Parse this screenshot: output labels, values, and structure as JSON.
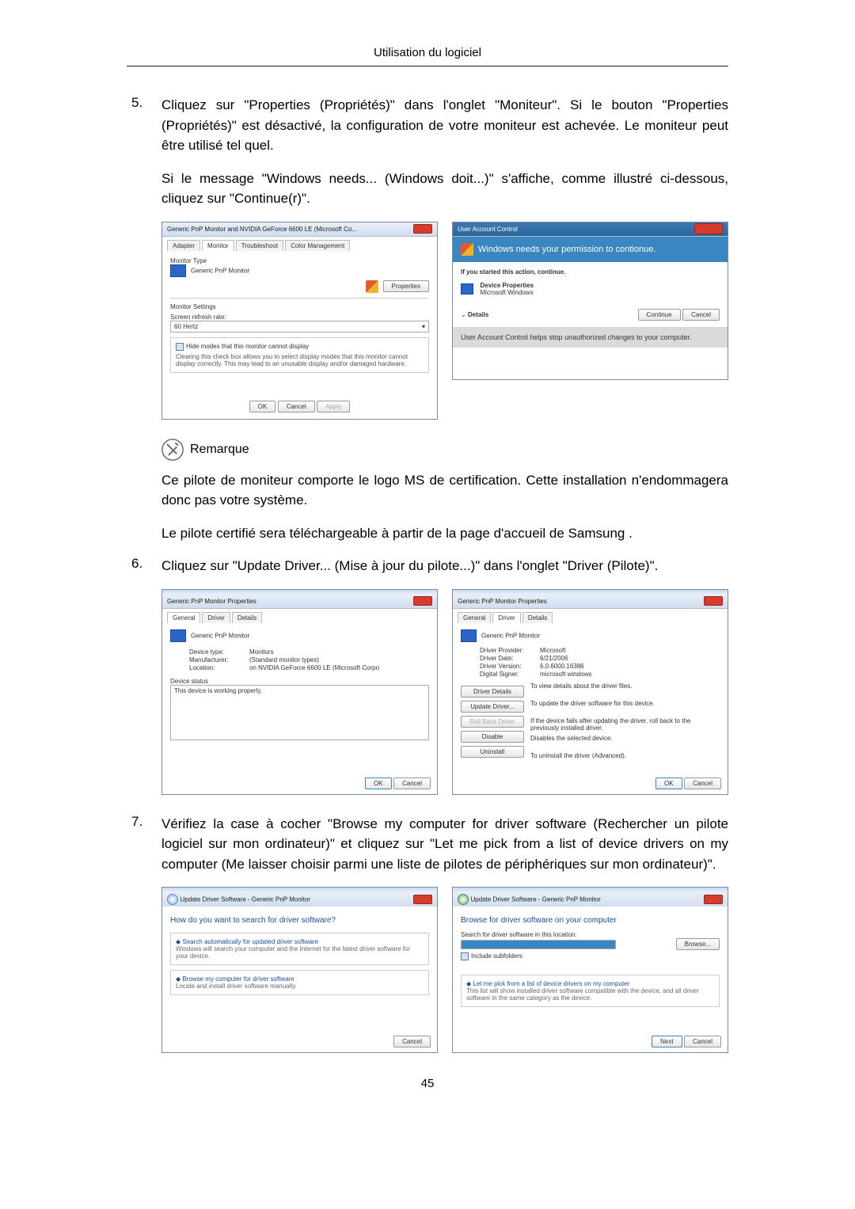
{
  "header": {
    "title": "Utilisation du logiciel"
  },
  "step5": {
    "num": "5.",
    "para1": "Cliquez sur \"Properties (Propriétés)\" dans l'onglet \"Moniteur\". Si le bouton \"Properties (Propriétés)\" est désactivé, la configuration de votre moniteur est achevée. Le moniteur peut être utilisé tel quel.",
    "para2": "Si le message \"Windows needs... (Windows doit...)\" s'affiche, comme illustré ci-dessous, cliquez sur \"Continue(r)\"."
  },
  "win1": {
    "title": "Generic PnP Monitor and NVIDIA GeForce 6600 LE (Microsoft Co...",
    "tabs": {
      "adapter": "Adapter",
      "monitor": "Monitor",
      "troubleshoot": "Troubleshoot",
      "color": "Color Management"
    },
    "monitor_type": "Monitor Type",
    "monitor_name": "Generic PnP Monitor",
    "properties": "Properties",
    "settings": "Monitor Settings",
    "refresh_lbl": "Screen refresh rate:",
    "refresh_val": "60 Hertz",
    "hide": "Hide modes that this monitor cannot display",
    "hide_desc": "Clearing this check box allows you to select display modes that this monitor cannot display correctly. This may lead to an unusable display and/or damaged hardware.",
    "ok": "OK",
    "cancel": "Cancel",
    "apply": "Apply"
  },
  "win2": {
    "title": "User Account Control",
    "bar": "Windows needs your permission to contionue.",
    "if_started": "If you started this action, continue.",
    "devprop": "Device Properties",
    "msw": "Microsoft Windows",
    "details": "Details",
    "continue": "Continue",
    "cancel": "Cancel",
    "helps": "User Account Control helps stop unauthorized changes to your computer."
  },
  "note": {
    "label": "Remarque",
    "p1": "Ce pilote de moniteur comporte le logo MS de certification. Cette installation n'endommagera donc pas votre système.",
    "p2": "Le pilote certifié sera téléchargeable à partir de la page d'accueil de Samsung ."
  },
  "step6": {
    "num": "6.",
    "para": "Cliquez sur \"Update Driver... (Mise à jour du pilote...)\" dans l'onglet \"Driver (Pilote)\"."
  },
  "win3": {
    "title": "Generic PnP Monitor Properties",
    "tabs": {
      "general": "General",
      "driver": "Driver",
      "details": "Details"
    },
    "name": "Generic PnP Monitor",
    "dt": "Device type:",
    "dt_v": "Monitors",
    "mf": "Manufacturer:",
    "mf_v": "(Standard monitor types)",
    "loc": "Location:",
    "loc_v": "on NVIDIA GeForce 6600 LE (Microsoft Corpo",
    "ds": "Device status",
    "ds_v": "This device is working properly.",
    "ok": "OK",
    "cancel": "Cancel"
  },
  "win4": {
    "title": "Generic PnP Monitor Properties",
    "tabs": {
      "general": "General",
      "driver": "Driver",
      "details": "Details"
    },
    "name": "Generic PnP Monitor",
    "dp": "Driver Provider:",
    "dp_v": "Microsoft",
    "dd": "Driver Date:",
    "dd_v": "6/21/2006",
    "dv": "Driver Version:",
    "dv_v": "6.0.6000.16386",
    "dsg": "Digital Signer:",
    "dsg_v": "microsoft windows",
    "b1": "Driver Details",
    "b1_d": "To view details about the driver files.",
    "b2": "Update Driver...",
    "b2_d": "To update the driver software for this device.",
    "b3": "Roll Back Driver",
    "b3_d": "If the device fails after updating the driver, roll back to the previously installed driver.",
    "b4": "Disable",
    "b4_d": "Disables the selected device.",
    "b5": "Uninstall",
    "b5_d": "To uninstall the driver (Advanced).",
    "ok": "OK",
    "cancel": "Cancel"
  },
  "step7": {
    "num": "7.",
    "para": "Vérifiez la case à cocher \"Browse my computer for driver software (Rechercher un pilote logiciel sur mon ordinateur)\" et cliquez sur \"Let me pick from a list of device drivers on my computer (Me laisser choisir parmi une liste de pilotes de périphériques sur mon ordinateur)\"."
  },
  "win5": {
    "title": "Update Driver Software - Generic PnP Monitor",
    "h": "How do you want to search for driver software?",
    "o1": "Search automatically for updated driver software",
    "o1d": "Windows will search your computer and the Internet for the latest driver software for your device.",
    "o2": "Browse my computer for driver software",
    "o2d": "Locate and install driver software manually.",
    "cancel": "Cancel"
  },
  "win6": {
    "title": "Update Driver Software - Generic PnP Monitor",
    "h": "Browse for driver software on your computer",
    "loc": "Search for driver software in this location:",
    "browse": "Browse...",
    "inc": "Include subfolders",
    "pick": "Let me pick from a list of device drivers on my computer",
    "pickd": "This list will show installed driver software compatible with the device, and all driver software in the same category as the device.",
    "next": "Next",
    "cancel": "Cancel"
  },
  "page_number": "45"
}
